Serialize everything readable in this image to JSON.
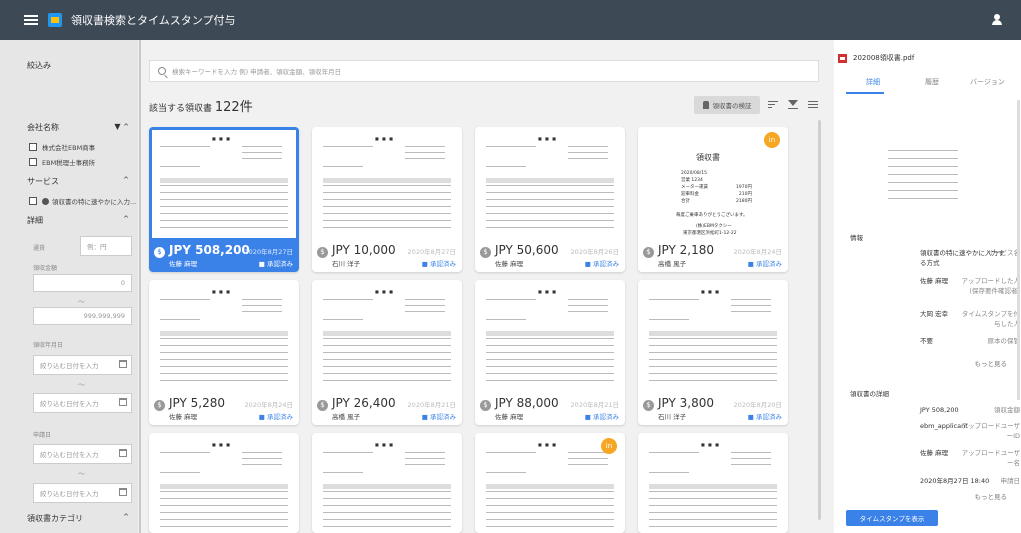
{
  "app": {
    "title": "領収書検索とタイムスタンプ付与"
  },
  "sidebar": {
    "title": "絞込み",
    "company": {
      "label": "会社名称",
      "filter_icon": "▼",
      "chevron": "^",
      "options": [
        "株式会社EBM商事",
        "EBM税理士事務所"
      ]
    },
    "service": {
      "label": "サービス",
      "chevron": "^",
      "options": [
        "領収書の特に速やかに入力..."
      ]
    },
    "detail": {
      "label": "詳細",
      "chevron": "^"
    },
    "currency": {
      "label": "通貨",
      "placeholder": "例：円"
    },
    "amount": {
      "label": "領収金額",
      "min": "0",
      "tilde": "～",
      "max": "999,999,999"
    },
    "receipt_date": {
      "label": "領収年月日",
      "placeholder_from": "絞り込む日付を入力",
      "tilde": "～",
      "placeholder_to": "絞り込む日付を入力"
    },
    "apply_date": {
      "label": "申請日",
      "placeholder_from": "絞り込む日付を入力",
      "tilde": "～",
      "placeholder_to": "絞り込む日付を入力"
    },
    "category": {
      "label": "領収書カテゴリ",
      "chevron": "^"
    }
  },
  "search": {
    "placeholder": "検索キーワードを入力 例) 申請者、領収金額、領収年月日"
  },
  "results": {
    "label": "該当する領収書",
    "count": "122件",
    "verify_label": "領収書の検証"
  },
  "cards": [
    {
      "amount": "JPY 508,200",
      "date": "2020年8月27日",
      "name": "佐藤 麻理",
      "status": "承認済み",
      "selected": true,
      "badge": ""
    },
    {
      "amount": "JPY 10,000",
      "date": "2020年8月27日",
      "name": "石川 洋子",
      "status": "承認済み",
      "selected": false,
      "badge": ""
    },
    {
      "amount": "JPY 50,600",
      "date": "2020年8月26日",
      "name": "佐藤 麻理",
      "status": "承認済み",
      "selected": false,
      "badge": ""
    },
    {
      "amount": "JPY 2,180",
      "date": "2020年8月24日",
      "name": "高橋 風子",
      "status": "承認済み",
      "selected": false,
      "badge": "in"
    },
    {
      "amount": "JPY 5,280",
      "date": "2020年8月24日",
      "name": "佐藤 麻理",
      "status": "承認済み",
      "selected": false,
      "badge": ""
    },
    {
      "amount": "JPY 26,400",
      "date": "2020年8月21日",
      "name": "高橋 風子",
      "status": "承認済み",
      "selected": false,
      "badge": ""
    },
    {
      "amount": "JPY 88,000",
      "date": "2020年8月21日",
      "name": "佐藤 麻理",
      "status": "承認済み",
      "selected": false,
      "badge": ""
    },
    {
      "amount": "JPY 3,800",
      "date": "2020年8月20日",
      "name": "石川 洋子",
      "status": "承認済み",
      "selected": false,
      "badge": ""
    },
    {
      "amount": "",
      "date": "",
      "name": "",
      "status": "",
      "selected": false,
      "badge": ""
    },
    {
      "amount": "",
      "date": "",
      "name": "",
      "status": "",
      "selected": false,
      "badge": ""
    },
    {
      "amount": "",
      "date": "",
      "name": "",
      "status": "",
      "selected": false,
      "badge": "in"
    },
    {
      "amount": "",
      "date": "",
      "name": "",
      "status": "",
      "selected": false,
      "badge": ""
    }
  ],
  "receipt_preview": {
    "title": "領収書",
    "rows": [
      "2020/08/15",
      "営業 1234",
      "メーター運賃",
      "迎車料金",
      "合計"
    ],
    "values": [
      "1970円",
      "210円",
      "2180円"
    ],
    "thanks": "毎度ご乗車ありがとうございます。",
    "company": "(株)EBMタクシー",
    "address": "東京都港区浜松町1-12-22"
  },
  "panel": {
    "file": "202008領収書.pdf",
    "tabs": [
      "詳細",
      "履歴",
      "バージョン"
    ],
    "info_title": "情報",
    "info": [
      {
        "k": "サービス名",
        "v": "領収書の特に速やかに入力する方式"
      },
      {
        "k": "アップロードした人(保存要件確認者)",
        "v": "佐藤 麻理"
      },
      {
        "k": "タイムスタンプを付与した人",
        "v": "大岡 宏幸"
      },
      {
        "k": "原本の保管",
        "v": "不要"
      }
    ],
    "more1": "もっと見る",
    "detail_title": "領収書の詳細",
    "detail": [
      {
        "k": "領収金額",
        "v": "JPY 508,200"
      },
      {
        "k": "アップロードユーザーID",
        "v": "ebm_applicant"
      },
      {
        "k": "アップロードユーザー名",
        "v": "佐藤 麻理"
      },
      {
        "k": "申請日",
        "v": "2020年8月27日 18:40"
      }
    ],
    "more2": "もっと見る",
    "timestamp_button": "タイムスタンプを表示"
  }
}
